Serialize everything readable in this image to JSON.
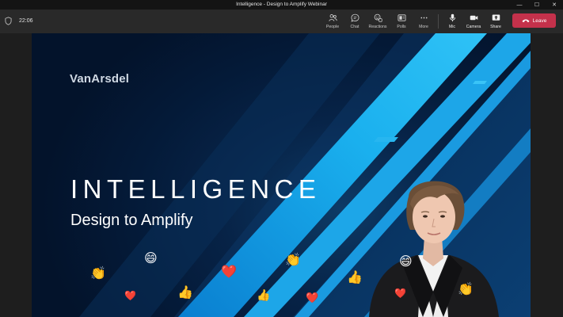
{
  "window": {
    "title": "Intelligence - Design to Amplify Webinar",
    "minimize_glyph": "—",
    "maximize_glyph": "☐",
    "close_glyph": "✕"
  },
  "toolbar": {
    "timer": "22:06",
    "people_label": "People",
    "chat_label": "Chat",
    "reactions_label": "Reactions",
    "polls_label": "Polls",
    "more_label": "More",
    "mic_label": "Mic",
    "camera_label": "Camera",
    "share_label": "Share",
    "leave_label": "Leave"
  },
  "slide": {
    "logo": "VanArsdel",
    "headline": "INTELLIGENCE",
    "subheadline": "Design to Amplify"
  },
  "reactions": {
    "clap": "👏",
    "laugh": "😄",
    "heart": "❤️",
    "thumbs_up": "👍"
  },
  "colors": {
    "leave": "#c4314b",
    "toolbar": "#292929",
    "accent_blue": "#1ab0ee"
  },
  "icons": [
    "shield-icon",
    "people-icon",
    "chat-icon",
    "reactions-icon",
    "polls-icon",
    "more-icon",
    "mic-icon",
    "camera-icon",
    "share-icon",
    "phone-hangup-icon"
  ]
}
